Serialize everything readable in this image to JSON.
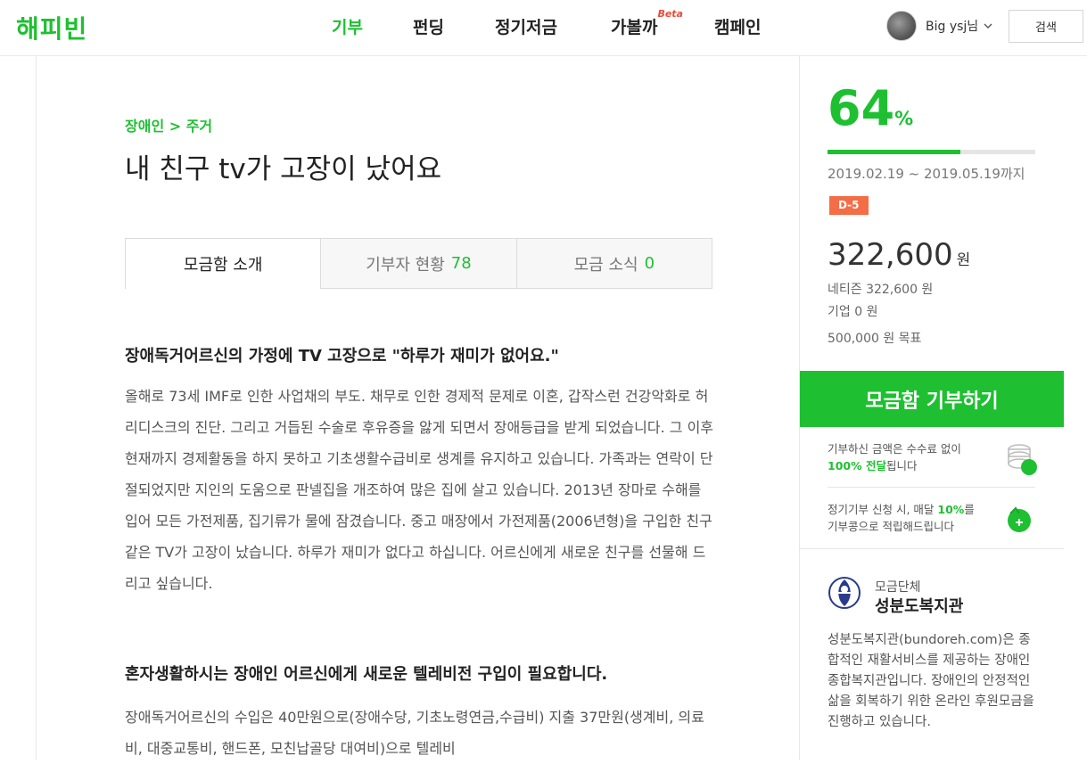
{
  "header": {
    "logo": "해피빈",
    "nav": [
      "기부",
      "펀딩",
      "정기저금",
      "가볼까",
      "캠페인"
    ],
    "beta": "Beta",
    "user_name": "Big ysj님",
    "search_label": "검색"
  },
  "page": {
    "breadcrumb": "장애인 > 주거",
    "title": "내 친구 tv가 고장이 났어요",
    "tabs": [
      {
        "label": "모금함 소개",
        "count": ""
      },
      {
        "label": "기부자 현황",
        "count": "78"
      },
      {
        "label": "모금 소식",
        "count": "0"
      }
    ],
    "heading1": "장애독거어르신의 가정에 TV 고장으로 \"하루가 재미가 없어요.\"",
    "body1": "올해로 73세 IMF로 인한 사업채의 부도. 채무로 인한 경제적 문제로 이혼, 갑작스런 건강악화로 허리디스크의 진단. 그리고 거듭된 수술로 후유증을 앓게 되면서 장애등급을 받게 되었습니다. 그 이후 현재까지 경제활동을 하지 못하고 기초생활수급비로 생계를 유지하고 있습니다. 가족과는 연락이 단절되었지만 지인의 도움으로 판넬집을 개조하여 많은 집에 살고 있습니다. 2013년 장마로 수해를 입어 모든 가전제품, 집기류가 물에 잠겼습니다. 중고 매장에서 가전제품(2006년형)을 구입한 친구 같은 TV가 고장이 났습니다. 하루가 재미가 없다고 하십니다. 어르신에게 새로운 친구를 선물해 드리고 싶습니다.",
    "heading2": "혼자생활하시는 장애인 어르신에게 새로운 텔레비전 구입이 필요합니다.",
    "body2": "장애독거어르신의 수입은 40만원으로(장애수당, 기초노령연금,수급비) 지출 37만원(생계비, 의료비, 대중교통비, 핸드폰, 모친납골당 대여비)으로 텔레비"
  },
  "sidebar": {
    "percent": "64",
    "percent_unit": "%",
    "progress": 0.64,
    "period": "2019.02.19 ~ 2019.05.19까지",
    "dday": "D-5",
    "amount": "322,600",
    "amount_unit": "원",
    "netizen": "네티즌 322,600 원",
    "company": "기업 0 원",
    "goal": "500,000 원 목표",
    "donate_button": "모금함 기부하기",
    "notice1_a": "기부하신 금액은 수수료 없이",
    "notice1_b": "100% 전달",
    "notice1_c": "됩니다",
    "notice2_a": "정기기부 신청 시, 매달 ",
    "notice2_b": "10%",
    "notice2_c": "를",
    "notice2_d": "기부콩으로 적립해드립니다",
    "org_label": "모금단체",
    "org_name": "성분도복지관",
    "org_desc": "성분도복지관(bundoreh.com)은 종합적인 재활서비스를 제공하는 장애인종합복지관입니다. 장애인의 안정적인 삶을 회복하기 위한 온라인 후원모금을 진행하고 있습니다."
  },
  "colors": {
    "brand_green": "#1ec031",
    "dday_orange": "#f46d46"
  }
}
